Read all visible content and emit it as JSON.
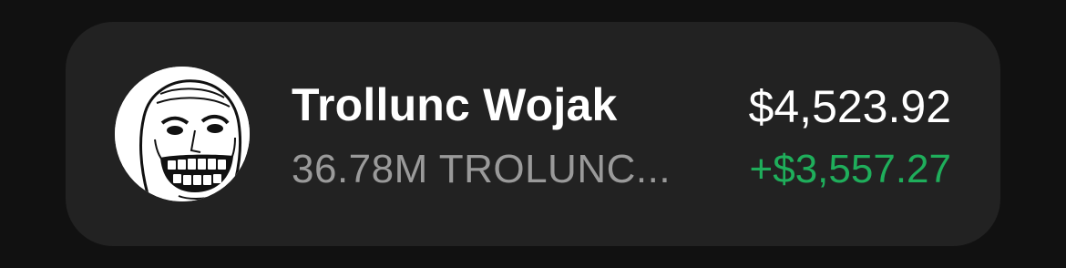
{
  "asset": {
    "name": "Trollunc Wojak",
    "holding": "36.78M TROLUNC",
    "value": "$4,523.92",
    "change": "+$3,557.27",
    "icon": "trollface-wojak-avatar"
  },
  "colors": {
    "background": "#111111",
    "card": "#222222",
    "change_positive": "#1fae5b",
    "secondary_text": "#9a9a9a"
  }
}
